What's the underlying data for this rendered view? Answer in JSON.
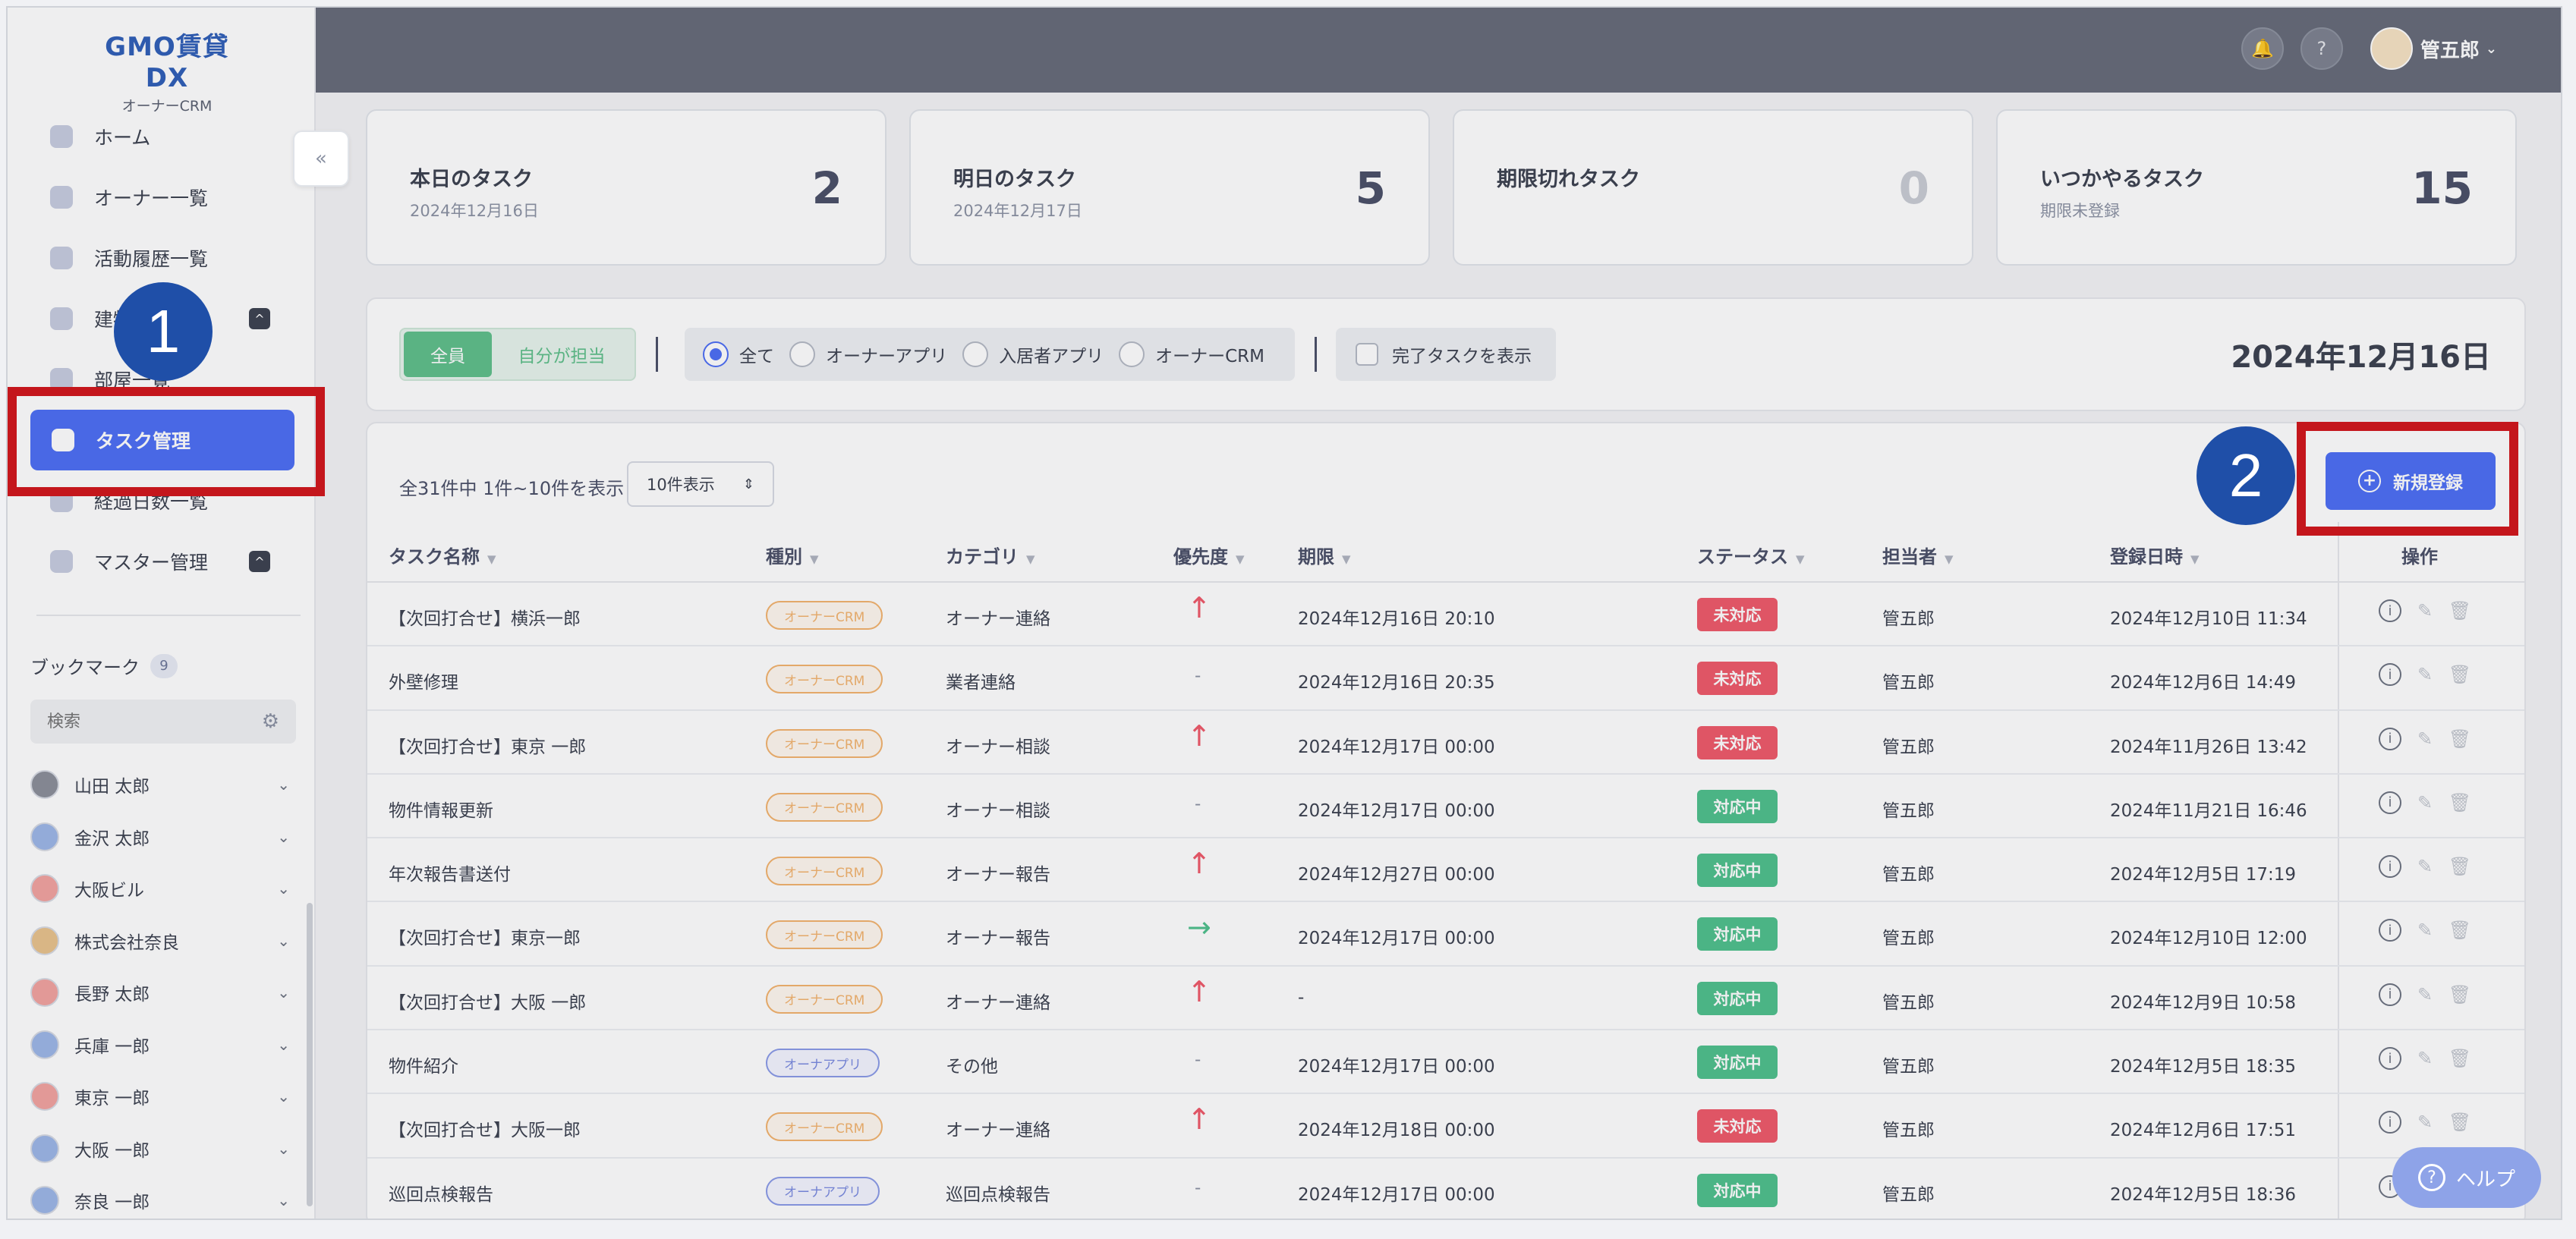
{
  "app": {
    "logo_main": "GMO賃貸DX",
    "logo_sub": "オーナーCRM"
  },
  "sidebar": {
    "items": [
      {
        "label": "ホーム",
        "icon": "grid-icon"
      },
      {
        "label": "オーナー一覧",
        "icon": "user-icon"
      },
      {
        "label": "活動履歴一覧",
        "icon": "document-icon"
      },
      {
        "label": "建物一覧",
        "icon": "building-icon"
      },
      {
        "label": "部屋一覧",
        "icon": "room-icon"
      },
      {
        "label": "タスク管理",
        "icon": "task-icon"
      },
      {
        "label": "経過日数一覧",
        "icon": "calendar-icon"
      },
      {
        "label": "マスター管理",
        "icon": "gear-icon"
      }
    ],
    "bookmark_title": "ブックマーク",
    "bookmark_count": "9",
    "search_placeholder": "検索",
    "bookmarks": [
      {
        "label": "山田 太郎",
        "color": "#8b8f99"
      },
      {
        "label": "金沢 太郎",
        "color": "#9db7e8"
      },
      {
        "label": "大阪ビル",
        "color": "#f2a3a0"
      },
      {
        "label": "株式会社奈良",
        "color": "#e9c38d"
      },
      {
        "label": "長野 太郎",
        "color": "#f2a3a0"
      },
      {
        "label": "兵庫 一郎",
        "color": "#9db7e8"
      },
      {
        "label": "東京 一郎",
        "color": "#f2a3a0"
      },
      {
        "label": "大阪 一郎",
        "color": "#9db7e8"
      },
      {
        "label": "奈良 一郎",
        "color": "#9db7e8"
      }
    ]
  },
  "header": {
    "user_name": "管五郎"
  },
  "cards": [
    {
      "title": "本日のタスク",
      "sub": "2024年12月16日",
      "num": "2"
    },
    {
      "title": "明日のタスク",
      "sub": "2024年12月17日",
      "num": "5"
    },
    {
      "title": "期限切れタスク",
      "sub": "",
      "num": "0"
    },
    {
      "title": "いつかやるタスク",
      "sub": "期限未登録",
      "num": "15"
    }
  ],
  "filters": {
    "seg_all": "全員",
    "seg_mine": "自分が担当",
    "radios": [
      "全て",
      "オーナーアプリ",
      "入居者アプリ",
      "オーナーCRM"
    ],
    "show_done": "完了タスクを表示",
    "date": "2024年12月16日"
  },
  "table": {
    "count_text": "全31件中 1件~10件を表示",
    "per_page": "10件表示",
    "new_button": "新規登録",
    "headers": [
      "タスク名称",
      "種別",
      "カテゴリ",
      "優先度",
      "期限",
      "ステータス",
      "担当者",
      "登録日時",
      "操作"
    ],
    "rows": [
      {
        "name": "【次回打合せ】横浜一郎",
        "type": "オーナーCRM",
        "type_kind": "crm",
        "category": "オーナー連絡",
        "priority": "up",
        "due": "2024年12月16日 20:10",
        "status": "未対応",
        "status_kind": "todo",
        "owner": "管五郎",
        "created": "2024年12月10日 11:34"
      },
      {
        "name": "外壁修理",
        "type": "オーナーCRM",
        "type_kind": "crm",
        "category": "業者連絡",
        "priority": "none",
        "due": "2024年12月16日 20:35",
        "status": "未対応",
        "status_kind": "todo",
        "owner": "管五郎",
        "created": "2024年12月6日 14:49"
      },
      {
        "name": "【次回打合せ】東京 一郎",
        "type": "オーナーCRM",
        "type_kind": "crm",
        "category": "オーナー相談",
        "priority": "up",
        "due": "2024年12月17日 00:00",
        "status": "未対応",
        "status_kind": "todo",
        "owner": "管五郎",
        "created": "2024年11月26日 13:42"
      },
      {
        "name": "物件情報更新",
        "type": "オーナーCRM",
        "type_kind": "crm",
        "category": "オーナー相談",
        "priority": "none",
        "due": "2024年12月17日 00:00",
        "status": "対応中",
        "status_kind": "doing",
        "owner": "管五郎",
        "created": "2024年11月21日 16:46"
      },
      {
        "name": "年次報告書送付",
        "type": "オーナーCRM",
        "type_kind": "crm",
        "category": "オーナー報告",
        "priority": "up",
        "due": "2024年12月27日 00:00",
        "status": "対応中",
        "status_kind": "doing",
        "owner": "管五郎",
        "created": "2024年12月5日 17:19"
      },
      {
        "name": "【次回打合せ】東京一郎",
        "type": "オーナーCRM",
        "type_kind": "crm",
        "category": "オーナー報告",
        "priority": "right",
        "due": "2024年12月17日 00:00",
        "status": "対応中",
        "status_kind": "doing",
        "owner": "管五郎",
        "created": "2024年12月10日 12:00"
      },
      {
        "name": "【次回打合せ】大阪 一郎",
        "type": "オーナーCRM",
        "type_kind": "crm",
        "category": "オーナー連絡",
        "priority": "up",
        "due": "-",
        "status": "対応中",
        "status_kind": "doing",
        "owner": "管五郎",
        "created": "2024年12月9日 10:58"
      },
      {
        "name": "物件紹介",
        "type": "オーナアプリ",
        "type_kind": "app",
        "category": "その他",
        "priority": "none",
        "due": "2024年12月17日 00:00",
        "status": "対応中",
        "status_kind": "doing",
        "owner": "管五郎",
        "created": "2024年12月5日 18:35"
      },
      {
        "name": "【次回打合せ】大阪一郎",
        "type": "オーナーCRM",
        "type_kind": "crm",
        "category": "オーナー連絡",
        "priority": "up",
        "due": "2024年12月18日 00:00",
        "status": "未対応",
        "status_kind": "todo",
        "owner": "管五郎",
        "created": "2024年12月6日 17:51"
      },
      {
        "name": "巡回点検報告",
        "type": "オーナアプリ",
        "type_kind": "app",
        "category": "巡回点検報告",
        "priority": "none",
        "due": "2024年12月17日 00:00",
        "status": "対応中",
        "status_kind": "doing",
        "owner": "管五郎",
        "created": "2024年12月5日 18:36"
      }
    ]
  },
  "annotations": {
    "marker1": "1",
    "marker2": "2"
  },
  "help_label": "ヘルプ"
}
